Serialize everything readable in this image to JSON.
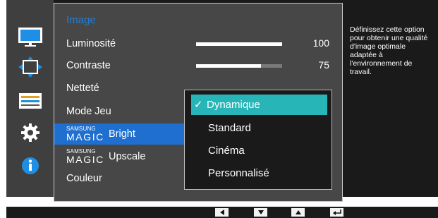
{
  "menu": {
    "title": "Image",
    "items": [
      {
        "label": "Luminosité",
        "value": "100",
        "level": 1.0
      },
      {
        "label": "Contraste",
        "value": "75",
        "level": 0.75
      },
      {
        "label": "Netteté"
      },
      {
        "label": "Mode Jeu"
      },
      {
        "brand": "SAMSUNG",
        "magic": "MAGIC",
        "label": "Bright"
      },
      {
        "brand": "SAMSUNG",
        "magic": "MAGIC",
        "label": "Upscale"
      },
      {
        "label": "Couleur"
      }
    ]
  },
  "submenu": {
    "options": [
      "Dynamique",
      "Standard",
      "Cinéma",
      "Personnalisé"
    ],
    "selected": "Dynamique"
  },
  "help_text": "Définissez cette option pour obtenir une qualité d'image optimale adaptée à l'environnement de travail.",
  "side_icons": [
    "monitor-icon",
    "move-arrows-icon",
    "menu-list-icon",
    "gear-icon",
    "info-icon"
  ],
  "nav_buttons": [
    "left-arrow-icon",
    "down-arrow-icon",
    "up-arrow-icon",
    "enter-icon"
  ],
  "colors": {
    "accent_blue": "#1f6fd0",
    "title_blue": "#1e7fd6",
    "selected_teal": "#27b5b8"
  }
}
